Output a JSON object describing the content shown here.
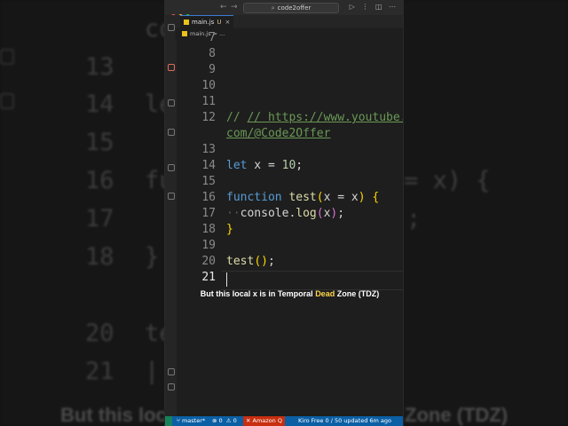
{
  "window": {
    "search_text": "code2offer",
    "tab": {
      "file": "main.js",
      "status": "U",
      "close": "×"
    },
    "breadcrumb": "main.js > ...",
    "title_icons": [
      "▷",
      "⋮",
      "◫",
      "⋯"
    ]
  },
  "editor": {
    "lines": [
      {
        "num": "7"
      },
      {
        "num": "8"
      },
      {
        "num": "9"
      },
      {
        "num": "10"
      },
      {
        "num": "11"
      },
      {
        "num": "12",
        "text": "// https://www.youtube.",
        "cont": "com/@Code2Offer"
      },
      {
        "num": "13"
      },
      {
        "num": "14",
        "text": "let x = 10;"
      },
      {
        "num": "15"
      },
      {
        "num": "16",
        "text": "function test(x = x) {"
      },
      {
        "num": "17",
        "text": "console.log(x);"
      },
      {
        "num": "18",
        "text": "}"
      },
      {
        "num": "19"
      },
      {
        "num": "20",
        "text": "test();"
      },
      {
        "num": "21"
      }
    ]
  },
  "caption": {
    "before": "But this local ",
    "var": "x",
    "middle": " is in Temporal ",
    "highlight": "Dead",
    "after": " Zone (TDZ)"
  },
  "statusbar": {
    "branch": "master*",
    "problems": "⊗ 0  ⚠ 0",
    "amazon": "✕ Amazon Q",
    "kiro": "Kiro Free 0 / 50 updated 6m ago"
  },
  "background": {
    "line_numbers": [
      "13",
      "14",
      "15",
      "16",
      "17",
      "18",
      "20",
      "21"
    ],
    "fragments": [
      "co",
      "le",
      "fu",
      "= x) {",
      ";",
      "}",
      "te",
      "|"
    ],
    "caption_left": "But this loc",
    "caption_right": "Zone (TDZ)"
  },
  "colors": {
    "keyword": "#569cd6",
    "function": "#dcdcaa",
    "comment": "#6a9955",
    "number": "#b5cea8",
    "highlight": "#ffd84a",
    "statusbar": "#0a5fa5"
  }
}
